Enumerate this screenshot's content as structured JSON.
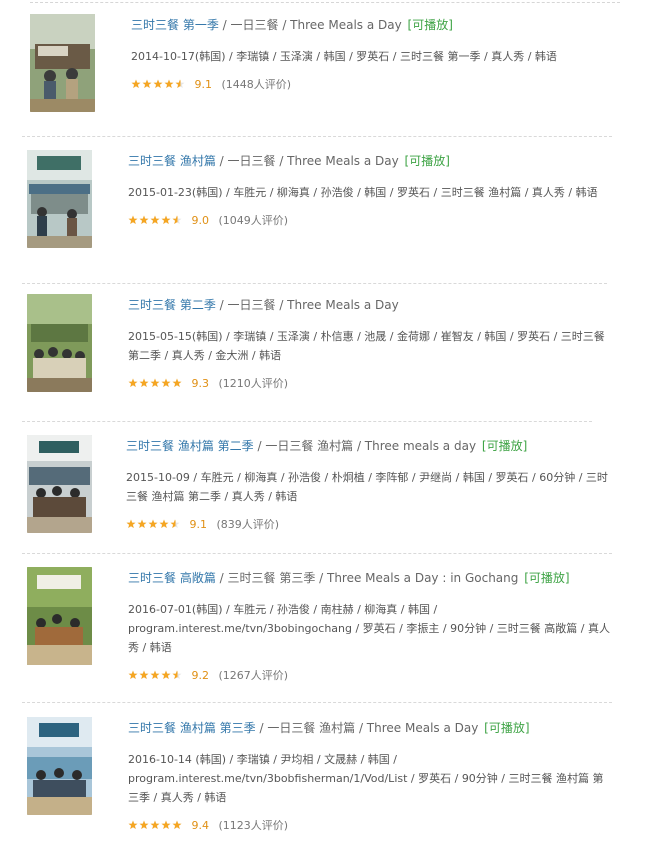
{
  "items": [
    {
      "title_main": "三时三餐 第一季",
      "title_alt": " / 一日三餐 / Three Meals a Day",
      "playable": "[可播放]",
      "meta": "2014-10-17(韩国) / 李瑞镇 / 玉泽演 / 韩国 / 罗英石 / 三时三餐 第一季 / 真人秀 / 韩语",
      "rating": "9.1",
      "rating_count": "(1448人评价)",
      "stars": 4.5
    },
    {
      "title_main": "三时三餐 渔村篇",
      "title_alt": " / 一日三餐 / Three Meals a Day",
      "playable": "[可播放]",
      "meta": "2015-01-23(韩国) / 车胜元 / 柳海真 / 孙浩俊 / 韩国 / 罗英石 / 三时三餐 渔村篇 / 真人秀 / 韩语",
      "rating": "9.0",
      "rating_count": "(1049人评价)",
      "stars": 4.5
    },
    {
      "title_main": "三时三餐 第二季",
      "title_alt": " / 一日三餐 / Three Meals a Day",
      "playable": "",
      "meta": "2015-05-15(韩国) / 李瑞镇 / 玉泽演 / 朴信惠 / 池晟 / 金荷娜 / 崔智友 / 韩国 / 罗英石 / 三时三餐 第二季 / 真人秀 / 金大洲 / 韩语",
      "rating": "9.3",
      "rating_count": "(1210人评价)",
      "stars": 5
    },
    {
      "title_main": "三时三餐 渔村篇 第二季",
      "title_alt": " / 一日三餐 渔村篇 / Three meals a day",
      "playable": "[可播放]",
      "meta": "2015-10-09 / 车胜元 / 柳海真 / 孙浩俊 / 朴炯植 / 李阵郁 / 尹继尚 / 韩国 / 罗英石 / 60分钟 / 三时三餐 渔村篇 第二季 / 真人秀 / 韩语",
      "rating": "9.1",
      "rating_count": "(839人评价)",
      "stars": 4.5
    },
    {
      "title_main": "三时三餐 高敞篇",
      "title_alt": " / 三时三餐 第三季 / Three Meals a Day : in Gochang",
      "playable": "[可播放]",
      "meta": "2016-07-01(韩国) / 车胜元 / 孙浩俊 / 南柱赫 / 柳海真 / 韩国 / program.interest.me/tvn/3bobingochang / 罗英石 / 李振主 / 90分钟 / 三时三餐 高敞篇 / 真人秀 / 韩语",
      "rating": "9.2",
      "rating_count": "(1267人评价)",
      "stars": 4.5
    },
    {
      "title_main": "三时三餐 渔村篇 第三季",
      "title_alt": " / 一日三餐 渔村篇 / Three Meals a Day",
      "playable": "[可播放]",
      "meta": "2016-10-14 (韩国) / 李瑞镇 / 尹均相 / 文晟赫 / 韩国 / program.interest.me/tvn/3bobfisherman/1/Vod/List / 罗英石 / 90分钟 / 三时三餐 渔村篇 第三季 / 真人秀 / 韩语",
      "rating": "9.4",
      "rating_count": "(1123人评价)",
      "stars": 5
    }
  ],
  "colors": {
    "title": "#3377aa",
    "playable": "#3ea345",
    "star": "#f5a623",
    "rating": "#e09015"
  }
}
